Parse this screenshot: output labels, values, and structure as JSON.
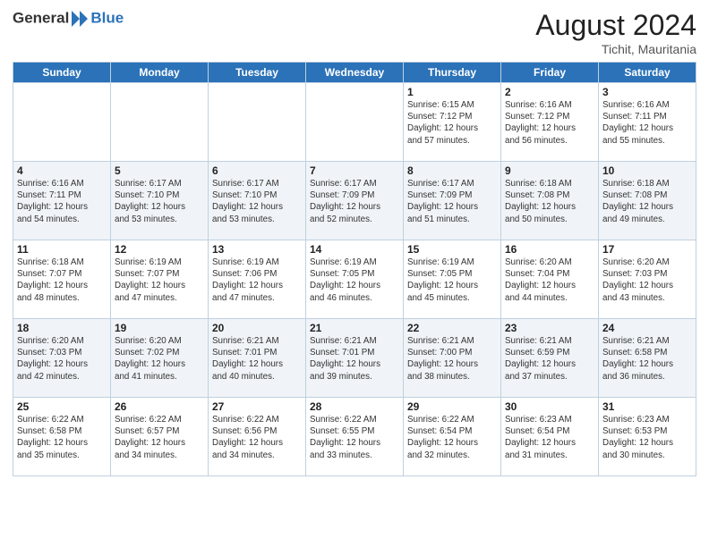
{
  "header": {
    "logo_general": "General",
    "logo_blue": "Blue",
    "month_year": "August 2024",
    "location": "Tichit, Mauritania"
  },
  "days_of_week": [
    "Sunday",
    "Monday",
    "Tuesday",
    "Wednesday",
    "Thursday",
    "Friday",
    "Saturday"
  ],
  "weeks": [
    [
      {
        "day": "",
        "info": ""
      },
      {
        "day": "",
        "info": ""
      },
      {
        "day": "",
        "info": ""
      },
      {
        "day": "",
        "info": ""
      },
      {
        "day": "1",
        "info": "Sunrise: 6:15 AM\nSunset: 7:12 PM\nDaylight: 12 hours\nand 57 minutes."
      },
      {
        "day": "2",
        "info": "Sunrise: 6:16 AM\nSunset: 7:12 PM\nDaylight: 12 hours\nand 56 minutes."
      },
      {
        "day": "3",
        "info": "Sunrise: 6:16 AM\nSunset: 7:11 PM\nDaylight: 12 hours\nand 55 minutes."
      }
    ],
    [
      {
        "day": "4",
        "info": "Sunrise: 6:16 AM\nSunset: 7:11 PM\nDaylight: 12 hours\nand 54 minutes."
      },
      {
        "day": "5",
        "info": "Sunrise: 6:17 AM\nSunset: 7:10 PM\nDaylight: 12 hours\nand 53 minutes."
      },
      {
        "day": "6",
        "info": "Sunrise: 6:17 AM\nSunset: 7:10 PM\nDaylight: 12 hours\nand 53 minutes."
      },
      {
        "day": "7",
        "info": "Sunrise: 6:17 AM\nSunset: 7:09 PM\nDaylight: 12 hours\nand 52 minutes."
      },
      {
        "day": "8",
        "info": "Sunrise: 6:17 AM\nSunset: 7:09 PM\nDaylight: 12 hours\nand 51 minutes."
      },
      {
        "day": "9",
        "info": "Sunrise: 6:18 AM\nSunset: 7:08 PM\nDaylight: 12 hours\nand 50 minutes."
      },
      {
        "day": "10",
        "info": "Sunrise: 6:18 AM\nSunset: 7:08 PM\nDaylight: 12 hours\nand 49 minutes."
      }
    ],
    [
      {
        "day": "11",
        "info": "Sunrise: 6:18 AM\nSunset: 7:07 PM\nDaylight: 12 hours\nand 48 minutes."
      },
      {
        "day": "12",
        "info": "Sunrise: 6:19 AM\nSunset: 7:07 PM\nDaylight: 12 hours\nand 47 minutes."
      },
      {
        "day": "13",
        "info": "Sunrise: 6:19 AM\nSunset: 7:06 PM\nDaylight: 12 hours\nand 47 minutes."
      },
      {
        "day": "14",
        "info": "Sunrise: 6:19 AM\nSunset: 7:05 PM\nDaylight: 12 hours\nand 46 minutes."
      },
      {
        "day": "15",
        "info": "Sunrise: 6:19 AM\nSunset: 7:05 PM\nDaylight: 12 hours\nand 45 minutes."
      },
      {
        "day": "16",
        "info": "Sunrise: 6:20 AM\nSunset: 7:04 PM\nDaylight: 12 hours\nand 44 minutes."
      },
      {
        "day": "17",
        "info": "Sunrise: 6:20 AM\nSunset: 7:03 PM\nDaylight: 12 hours\nand 43 minutes."
      }
    ],
    [
      {
        "day": "18",
        "info": "Sunrise: 6:20 AM\nSunset: 7:03 PM\nDaylight: 12 hours\nand 42 minutes."
      },
      {
        "day": "19",
        "info": "Sunrise: 6:20 AM\nSunset: 7:02 PM\nDaylight: 12 hours\nand 41 minutes."
      },
      {
        "day": "20",
        "info": "Sunrise: 6:21 AM\nSunset: 7:01 PM\nDaylight: 12 hours\nand 40 minutes."
      },
      {
        "day": "21",
        "info": "Sunrise: 6:21 AM\nSunset: 7:01 PM\nDaylight: 12 hours\nand 39 minutes."
      },
      {
        "day": "22",
        "info": "Sunrise: 6:21 AM\nSunset: 7:00 PM\nDaylight: 12 hours\nand 38 minutes."
      },
      {
        "day": "23",
        "info": "Sunrise: 6:21 AM\nSunset: 6:59 PM\nDaylight: 12 hours\nand 37 minutes."
      },
      {
        "day": "24",
        "info": "Sunrise: 6:21 AM\nSunset: 6:58 PM\nDaylight: 12 hours\nand 36 minutes."
      }
    ],
    [
      {
        "day": "25",
        "info": "Sunrise: 6:22 AM\nSunset: 6:58 PM\nDaylight: 12 hours\nand 35 minutes."
      },
      {
        "day": "26",
        "info": "Sunrise: 6:22 AM\nSunset: 6:57 PM\nDaylight: 12 hours\nand 34 minutes."
      },
      {
        "day": "27",
        "info": "Sunrise: 6:22 AM\nSunset: 6:56 PM\nDaylight: 12 hours\nand 34 minutes."
      },
      {
        "day": "28",
        "info": "Sunrise: 6:22 AM\nSunset: 6:55 PM\nDaylight: 12 hours\nand 33 minutes."
      },
      {
        "day": "29",
        "info": "Sunrise: 6:22 AM\nSunset: 6:54 PM\nDaylight: 12 hours\nand 32 minutes."
      },
      {
        "day": "30",
        "info": "Sunrise: 6:23 AM\nSunset: 6:54 PM\nDaylight: 12 hours\nand 31 minutes."
      },
      {
        "day": "31",
        "info": "Sunrise: 6:23 AM\nSunset: 6:53 PM\nDaylight: 12 hours\nand 30 minutes."
      }
    ]
  ]
}
